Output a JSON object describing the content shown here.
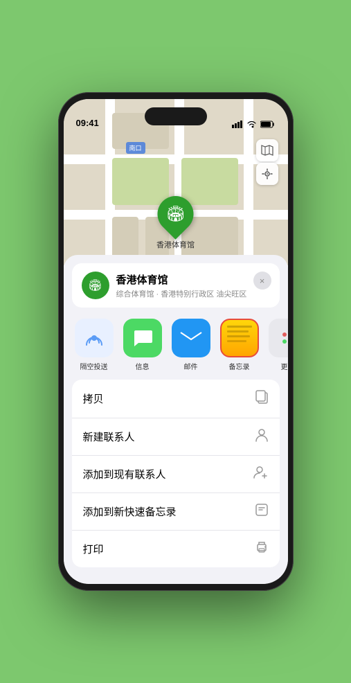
{
  "status_bar": {
    "time": "09:41",
    "location_arrow": true
  },
  "map": {
    "label": "南口",
    "map_icon": "🗺",
    "location_icon": "⊙"
  },
  "venue_pin": {
    "label": "香港体育馆",
    "icon": "🏟"
  },
  "venue_card": {
    "name": "香港体育馆",
    "subtitle": "综合体育馆 · 香港特别行政区 油尖旺区",
    "close_label": "×"
  },
  "share_items": [
    {
      "id": "airdrop",
      "label": "隔空投送",
      "icon": "wifi",
      "bg": "#e8f0ff",
      "highlighted": false
    },
    {
      "id": "message",
      "label": "信息",
      "icon": "message",
      "bg": "#4cd964",
      "highlighted": false
    },
    {
      "id": "mail",
      "label": "邮件",
      "icon": "mail",
      "bg": "#2196f3",
      "highlighted": false
    },
    {
      "id": "notes",
      "label": "备忘录",
      "icon": "notes",
      "bg": "notes",
      "highlighted": true
    },
    {
      "id": "more",
      "label": "更多",
      "icon": "more",
      "bg": "more",
      "highlighted": false
    }
  ],
  "action_rows": [
    {
      "id": "copy",
      "label": "拷贝",
      "icon": "copy"
    },
    {
      "id": "new-contact",
      "label": "新建联系人",
      "icon": "person"
    },
    {
      "id": "add-contact",
      "label": "添加到现有联系人",
      "icon": "person-add"
    },
    {
      "id": "quick-note",
      "label": "添加到新快速备忘录",
      "icon": "note"
    },
    {
      "id": "print",
      "label": "打印",
      "icon": "print"
    }
  ]
}
